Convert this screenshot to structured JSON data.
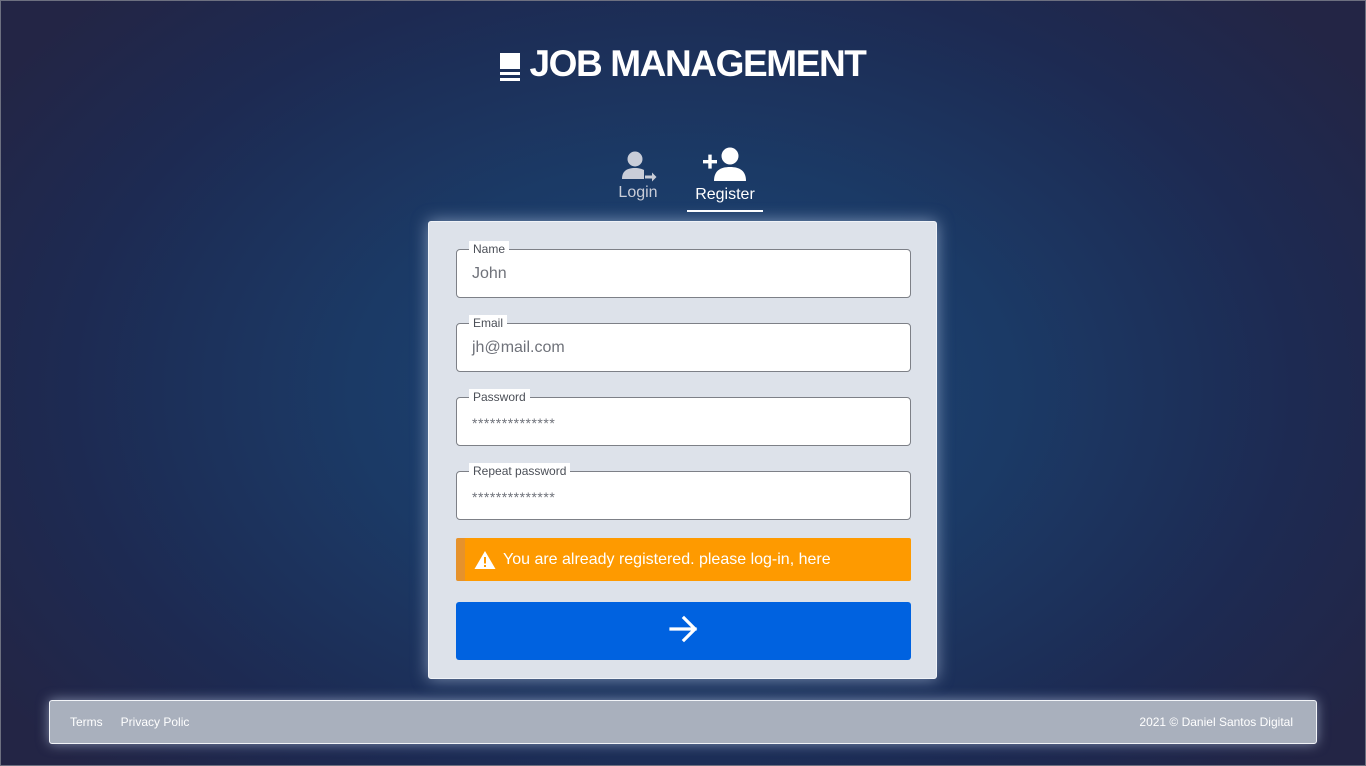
{
  "brand": {
    "title": "JOB MANAGEMENT"
  },
  "tabs": [
    {
      "label": "Login",
      "icon": "user-login-icon",
      "active": false
    },
    {
      "label": "Register",
      "icon": "user-add-icon",
      "active": true
    }
  ],
  "form": {
    "fields": [
      {
        "label": "Name",
        "value": "John"
      },
      {
        "label": "Email",
        "value": "jh@mail.com"
      },
      {
        "label": "Password",
        "value": "**************"
      },
      {
        "label": "Repeat password",
        "value": "**************"
      }
    ],
    "alert": {
      "icon": "warning-icon",
      "text": "You are already registered. please log-in, here"
    },
    "submit_icon": "arrow-right-icon"
  },
  "footer": {
    "links": [
      "Terms",
      "Privacy Polic"
    ],
    "copyright": "2021 © Daniel Santos Digital"
  },
  "colors": {
    "primary": "#0062e0",
    "warning": "#fe9a00",
    "background": "#1b3a66"
  }
}
